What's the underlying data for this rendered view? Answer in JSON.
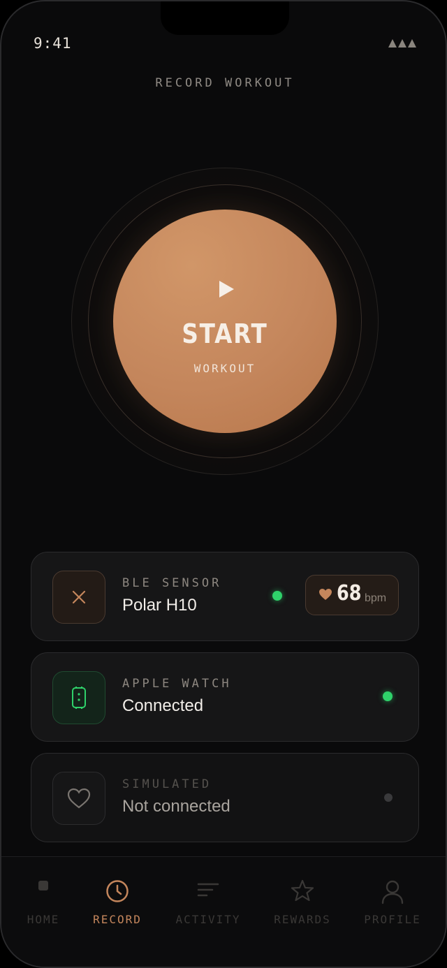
{
  "status_bar": {
    "time": "9:41",
    "signal_icon": "signal-bars-icon"
  },
  "header": {
    "title": "RECORD WORKOUT"
  },
  "start": {
    "label": "START",
    "sublabel": "WORKOUT",
    "icon": "play-icon",
    "accent": "#c4865c"
  },
  "sources": [
    {
      "kicker": "BLE SENSOR",
      "value": "Polar H10",
      "icon": "close-icon",
      "status": "connected",
      "status_color": "#2fd16a",
      "heart_rate": {
        "value": "68",
        "unit": "bpm",
        "icon": "heart-icon"
      }
    },
    {
      "kicker": "APPLE WATCH",
      "value": "Connected",
      "icon": "watch-icon",
      "status": "connected",
      "status_color": "#2fd16a"
    },
    {
      "kicker": "SIMULATED",
      "value": "Not connected",
      "icon": "heart-outline-icon",
      "status": "disconnected",
      "status_color": "#3a3a3c"
    }
  ],
  "tabs": [
    {
      "label": "HOME",
      "icon": "home-icon",
      "active": false
    },
    {
      "label": "RECORD",
      "icon": "clock-icon",
      "active": true
    },
    {
      "label": "ACTIVITY",
      "icon": "list-icon",
      "active": false
    },
    {
      "label": "REWARDS",
      "icon": "star-icon",
      "active": false
    },
    {
      "label": "PROFILE",
      "icon": "person-icon",
      "active": false
    }
  ],
  "colors": {
    "active_tab": "#c4865c",
    "inactive_tab": "#3a3836",
    "green": "#2fd16a"
  }
}
